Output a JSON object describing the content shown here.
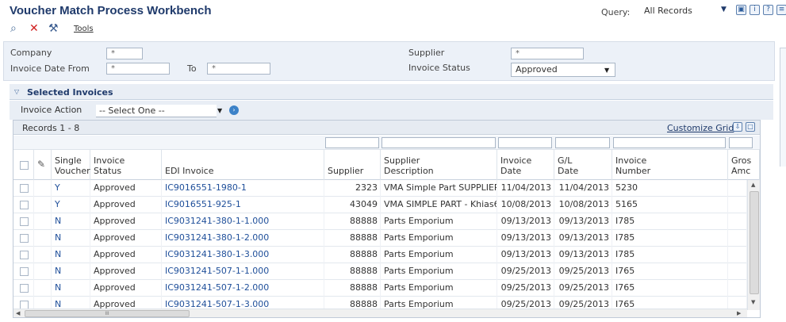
{
  "header": {
    "title": "Voucher Match Process Workbench",
    "query_label": "Query:",
    "query_value": "All Records"
  },
  "toolbar": {
    "tools_label": "Tools"
  },
  "filters": {
    "company_label": "Company",
    "company_value": "*",
    "invoice_date_from_label": "Invoice Date From",
    "invoice_date_from_value": "*",
    "to_label": "To",
    "to_value": "*",
    "supplier_label": "Supplier",
    "supplier_value": "*",
    "invoice_status_label": "Invoice Status",
    "invoice_status_value": "Approved"
  },
  "section": {
    "title": "Selected Invoices",
    "invoice_action_label": "Invoice Action",
    "invoice_action_value": "-- Select One --"
  },
  "grid": {
    "records_label": "Records 1 - 8",
    "customize_label": "Customize Grid",
    "columns": {
      "single_voucher": "Single\nVoucher",
      "invoice_status": "Invoice\nStatus",
      "edi_invoice": "EDI Invoice",
      "supplier": "Supplier",
      "supplier_description": "Supplier\nDescription",
      "invoice_date": "Invoice\nDate",
      "gl_date": "G/L\nDate",
      "invoice_number": "Invoice\nNumber",
      "gross_amount": "Gros\nAmc"
    },
    "rows": [
      {
        "single_voucher": "Y",
        "status": "Approved",
        "edi_invoice": "IC9016551-1980-1",
        "supplier": "2323",
        "description": "VMA Simple Part SUPPLIER",
        "invoice_date": "11/04/2013",
        "gl_date": "11/04/2013",
        "invoice_number": "5230"
      },
      {
        "single_voucher": "Y",
        "status": "Approved",
        "edi_invoice": "IC9016551-925-1",
        "supplier": "43049",
        "description": "VMA SIMPLE PART - Khias6",
        "invoice_date": "10/08/2013",
        "gl_date": "10/08/2013",
        "invoice_number": "5165"
      },
      {
        "single_voucher": "N",
        "status": "Approved",
        "edi_invoice": "IC9031241-380-1-1.000",
        "supplier": "88888",
        "description": "Parts Emporium",
        "invoice_date": "09/13/2013",
        "gl_date": "09/13/2013",
        "invoice_number": "I785"
      },
      {
        "single_voucher": "N",
        "status": "Approved",
        "edi_invoice": "IC9031241-380-1-2.000",
        "supplier": "88888",
        "description": "Parts Emporium",
        "invoice_date": "09/13/2013",
        "gl_date": "09/13/2013",
        "invoice_number": "I785"
      },
      {
        "single_voucher": "N",
        "status": "Approved",
        "edi_invoice": "IC9031241-380-1-3.000",
        "supplier": "88888",
        "description": "Parts Emporium",
        "invoice_date": "09/13/2013",
        "gl_date": "09/13/2013",
        "invoice_number": "I785"
      },
      {
        "single_voucher": "N",
        "status": "Approved",
        "edi_invoice": "IC9031241-507-1-1.000",
        "supplier": "88888",
        "description": "Parts Emporium",
        "invoice_date": "09/25/2013",
        "gl_date": "09/25/2013",
        "invoice_number": "I765"
      },
      {
        "single_voucher": "N",
        "status": "Approved",
        "edi_invoice": "IC9031241-507-1-2.000",
        "supplier": "88888",
        "description": "Parts Emporium",
        "invoice_date": "09/25/2013",
        "gl_date": "09/25/2013",
        "invoice_number": "I765"
      },
      {
        "single_voucher": "N",
        "status": "Approved",
        "edi_invoice": "IC9031241-507-1-3.000",
        "supplier": "88888",
        "description": "Parts Emporium",
        "invoice_date": "09/25/2013",
        "gl_date": "09/25/2013",
        "invoice_number": "I765"
      }
    ]
  },
  "scroll": {
    "hscroll_grip": "III"
  },
  "colors": {
    "title": "#1f3a6b",
    "link": "#1f4f9a",
    "panel": "#ecf1f8"
  }
}
